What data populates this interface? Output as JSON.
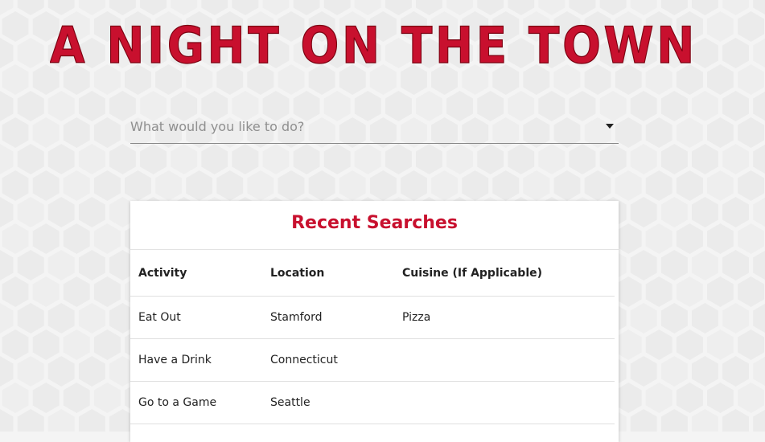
{
  "page": {
    "title": "A NIGHT ON THE TOWN"
  },
  "search": {
    "placeholder": "What would you like to do?",
    "icon": "chevron-down-icon"
  },
  "recent": {
    "heading": "Recent Searches",
    "columns": [
      "Activity",
      "Location",
      "Cuisine (If Applicable)"
    ],
    "rows": [
      [
        "Eat Out",
        "Stamford",
        "Pizza"
      ],
      [
        "Have a Drink",
        "Connecticut",
        ""
      ],
      [
        "Go to a Game",
        "Seattle",
        ""
      ]
    ]
  },
  "colors": {
    "accent": "#c8102e",
    "background": "#f4f4f4",
    "hex_pattern": "#e8e8e8"
  }
}
